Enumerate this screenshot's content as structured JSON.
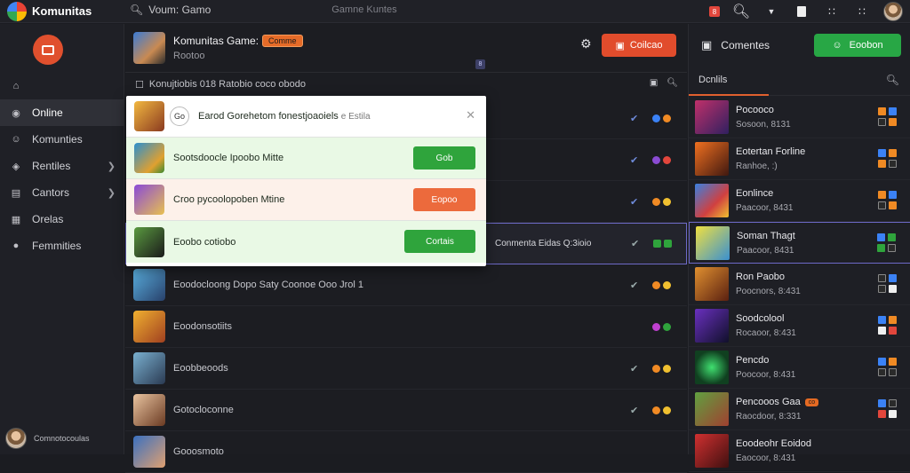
{
  "app": {
    "name": "Komunitas"
  },
  "search": {
    "value": "Voum: Gamo",
    "placeholder": "Gamne  Kuntes"
  },
  "topbar": {
    "notification_badge": "8"
  },
  "sidebar": {
    "items": [
      {
        "label": "",
        "icon": "home-icon"
      },
      {
        "label": "Online",
        "icon": "online-icon",
        "active": true
      },
      {
        "label": "Komunties",
        "icon": "users-icon"
      },
      {
        "label": "Rentiles",
        "icon": "gamepad-icon",
        "chevron": true
      },
      {
        "label": "Cantors",
        "icon": "folder-icon",
        "chevron": true
      },
      {
        "label": "Orelas",
        "icon": "calendar-icon"
      },
      {
        "label": "Femmities",
        "icon": "chat-icon"
      }
    ],
    "user_label": "Comnotocoulas"
  },
  "game_header": {
    "title": "Komunitas Game:",
    "tag": "Comme",
    "subtitle": "Rootoo",
    "join_label": "Coilcao",
    "mini_badge": "8"
  },
  "filterbar": {
    "text": "Konujtiobis  018  Ratobio  coco obodo"
  },
  "popup": {
    "rows": [
      {
        "text": "Earod Gorehetom fonestjoaoiels",
        "extra": "e Estila",
        "circle": "Go",
        "kind": "white"
      },
      {
        "text": "Sootsdoocle  Ipoobo Mitte",
        "button": "Gob",
        "kind": "green"
      },
      {
        "text": "Croo  pycoolopoben  Mtine",
        "button": "Eopoo",
        "kind": "orange"
      },
      {
        "text": "Eoobo cotiobo",
        "button": "Cortais",
        "kind": "green"
      }
    ]
  },
  "list": {
    "rows": [
      {
        "label": "",
        "check": true
      },
      {
        "label": "",
        "check": true
      },
      {
        "label": "",
        "check": true
      },
      {
        "label": "",
        "extra": "Conmenta Eidas  Q:3ioio",
        "selected": true
      },
      {
        "label": "Eoodocloong  Dopo Saty  Coonoe Ooo  Jrol  1"
      },
      {
        "label": "Eoodonsotiits"
      },
      {
        "label": "Eoobbeoods"
      },
      {
        "label": "Gotocloconne"
      },
      {
        "label": "Gooosmoto"
      }
    ]
  },
  "right_panel": {
    "header": "Comentes",
    "join_label": "Eoobon",
    "tab": "Dcnlils",
    "items": [
      {
        "name": "Pocooco",
        "sub": "Sosoon, 8131"
      },
      {
        "name": "Eotertan Forline",
        "sub": "Ranhoe, :)"
      },
      {
        "name": "Eonlince",
        "sub": "Paacoor, 8431"
      },
      {
        "name": "Soman Thagt",
        "sub": "Paacoor, 8431",
        "selected": true
      },
      {
        "name": "Ron Paobo",
        "sub": "Poocnors, 8:431"
      },
      {
        "name": "Soodcolool",
        "sub": "Rocaoor, 8:431"
      },
      {
        "name": "Pencdo",
        "sub": "Poocoor, 8:431"
      },
      {
        "name": "Pencooos Gaa",
        "sub": "Raocdoor, 8:331",
        "badge": "co"
      },
      {
        "name": "Eoodeohr Eoidod",
        "sub": "Eaocoor, 8:431"
      }
    ]
  },
  "colors": {
    "accent_orange": "#e14c2c",
    "accent_green": "#28a745",
    "selection": "#6e6ac8"
  }
}
